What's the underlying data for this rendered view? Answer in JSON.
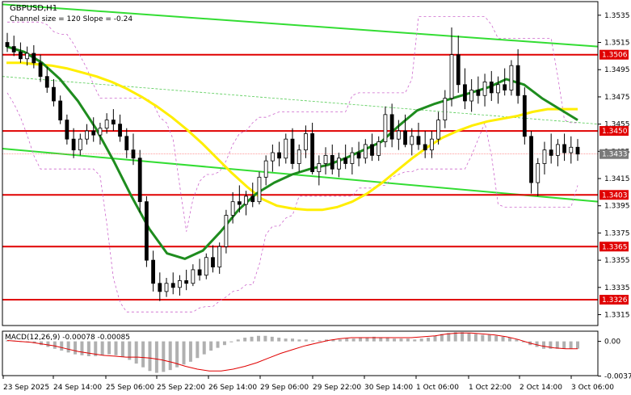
{
  "chart_data": {
    "type": "candlestick",
    "symbol_title": "GBPUSD,H1",
    "subtitle": "Channel size = 120 Slope = -0.24",
    "price_axis": {
      "ylim": [
        1.3307,
        1.3545
      ],
      "ticks": [
        "1.3535",
        "1.3515",
        "1.3495",
        "1.3475",
        "1.3455",
        "1.3435",
        "1.3415",
        "1.3395",
        "1.3375",
        "1.3355",
        "1.3335",
        "1.3315"
      ]
    },
    "levels": [
      {
        "label": "1.3506",
        "value": 1.3506
      },
      {
        "label": "1.3450",
        "value": 1.345
      },
      {
        "label": "1.3403",
        "value": 1.3403
      },
      {
        "label": "1.3365",
        "value": 1.3365
      },
      {
        "label": "1.3326",
        "value": 1.3326
      }
    ],
    "current_price": {
      "label": "1.3433",
      "value": 1.3433
    },
    "x_labels": [
      "23 Sep 2025",
      "24 Sep 14:00",
      "25 Sep 06:00",
      "25 Sep 22:00",
      "26 Sep 14:00",
      "29 Sep 06:00",
      "29 Sep 22:00",
      "30 Sep 14:00",
      "1 Oct 06:00",
      "1 Oct 22:00",
      "2 Oct 14:00",
      "3 Oct 06:00"
    ],
    "candles_ohlc": [
      [
        1.3515,
        1.3522,
        1.3508,
        1.3512
      ],
      [
        1.3512,
        1.352,
        1.3505,
        1.3508
      ],
      [
        1.3508,
        1.3515,
        1.35,
        1.3503
      ],
      [
        1.3503,
        1.3512,
        1.3498,
        1.3507
      ],
      [
        1.3507,
        1.3513,
        1.3496,
        1.35
      ],
      [
        1.35,
        1.3506,
        1.3486,
        1.349
      ],
      [
        1.349,
        1.3497,
        1.3478,
        1.3482
      ],
      [
        1.3482,
        1.3488,
        1.3468,
        1.3472
      ],
      [
        1.3472,
        1.3476,
        1.3455,
        1.3458
      ],
      [
        1.3458,
        1.3462,
        1.344,
        1.3444
      ],
      [
        1.3444,
        1.3452,
        1.343,
        1.3436
      ],
      [
        1.3436,
        1.3448,
        1.3432,
        1.3444
      ],
      [
        1.3444,
        1.3455,
        1.344,
        1.345
      ],
      [
        1.345,
        1.346,
        1.3442,
        1.3447
      ],
      [
        1.3447,
        1.3456,
        1.344,
        1.3452
      ],
      [
        1.3452,
        1.3463,
        1.3448,
        1.3458
      ],
      [
        1.3458,
        1.3466,
        1.345,
        1.3455
      ],
      [
        1.3455,
        1.3462,
        1.3442,
        1.3446
      ],
      [
        1.3446,
        1.3452,
        1.343,
        1.3436
      ],
      [
        1.3436,
        1.3448,
        1.3425,
        1.343
      ],
      [
        1.343,
        1.3436,
        1.339,
        1.3398
      ],
      [
        1.3398,
        1.3402,
        1.335,
        1.3355
      ],
      [
        1.3355,
        1.3362,
        1.3332,
        1.3338
      ],
      [
        1.3338,
        1.3346,
        1.3325,
        1.3332
      ],
      [
        1.3332,
        1.3342,
        1.3328,
        1.3338
      ],
      [
        1.3338,
        1.3346,
        1.333,
        1.3335
      ],
      [
        1.3335,
        1.3344,
        1.3329,
        1.334
      ],
      [
        1.334,
        1.3348,
        1.3333,
        1.3338
      ],
      [
        1.3338,
        1.3352,
        1.3336,
        1.3348
      ],
      [
        1.3348,
        1.3356,
        1.334,
        1.3344
      ],
      [
        1.3344,
        1.336,
        1.3341,
        1.3357
      ],
      [
        1.3357,
        1.3366,
        1.3346,
        1.335
      ],
      [
        1.335,
        1.3368,
        1.3345,
        1.3365
      ],
      [
        1.3365,
        1.3392,
        1.336,
        1.3388
      ],
      [
        1.3388,
        1.3405,
        1.3382,
        1.3398
      ],
      [
        1.3398,
        1.341,
        1.339,
        1.3396
      ],
      [
        1.3396,
        1.3406,
        1.3388,
        1.3402
      ],
      [
        1.3402,
        1.3412,
        1.3394,
        1.3398
      ],
      [
        1.3398,
        1.342,
        1.3396,
        1.3416
      ],
      [
        1.3416,
        1.3432,
        1.341,
        1.3428
      ],
      [
        1.3428,
        1.344,
        1.342,
        1.3434
      ],
      [
        1.3434,
        1.3442,
        1.3424,
        1.343
      ],
      [
        1.343,
        1.3448,
        1.3426,
        1.3444
      ],
      [
        1.3444,
        1.3452,
        1.3422,
        1.3426
      ],
      [
        1.3426,
        1.344,
        1.342,
        1.3436
      ],
      [
        1.3436,
        1.3454,
        1.343,
        1.3448
      ],
      [
        1.3448,
        1.3456,
        1.3418,
        1.342
      ],
      [
        1.342,
        1.3432,
        1.341,
        1.3426
      ],
      [
        1.3426,
        1.3438,
        1.3418,
        1.3432
      ],
      [
        1.3432,
        1.344,
        1.3418,
        1.3422
      ],
      [
        1.3422,
        1.3434,
        1.3416,
        1.343
      ],
      [
        1.343,
        1.344,
        1.3422,
        1.3426
      ],
      [
        1.3426,
        1.3438,
        1.3418,
        1.3434
      ],
      [
        1.3434,
        1.3442,
        1.3424,
        1.343
      ],
      [
        1.343,
        1.3444,
        1.3426,
        1.344
      ],
      [
        1.344,
        1.3448,
        1.3428,
        1.3432
      ],
      [
        1.3432,
        1.3446,
        1.3428,
        1.3442
      ],
      [
        1.3442,
        1.3468,
        1.3438,
        1.3462
      ],
      [
        1.3462,
        1.347,
        1.3438,
        1.3444
      ],
      [
        1.3444,
        1.3458,
        1.3436,
        1.345
      ],
      [
        1.345,
        1.3462,
        1.3438,
        1.344
      ],
      [
        1.344,
        1.3452,
        1.3432,
        1.3446
      ],
      [
        1.3446,
        1.3456,
        1.3436,
        1.344
      ],
      [
        1.344,
        1.345,
        1.343,
        1.3436
      ],
      [
        1.3436,
        1.345,
        1.343,
        1.3444
      ],
      [
        1.3444,
        1.3464,
        1.344,
        1.3458
      ],
      [
        1.3458,
        1.348,
        1.3452,
        1.3474
      ],
      [
        1.3474,
        1.3526,
        1.3468,
        1.3506
      ],
      [
        1.3506,
        1.352,
        1.3478,
        1.3484
      ],
      [
        1.3484,
        1.3496,
        1.3466,
        1.3472
      ],
      [
        1.3472,
        1.3488,
        1.3464,
        1.348
      ],
      [
        1.348,
        1.349,
        1.347,
        1.3476
      ],
      [
        1.3476,
        1.3492,
        1.3468,
        1.3486
      ],
      [
        1.3486,
        1.3494,
        1.3472,
        1.3478
      ],
      [
        1.3478,
        1.349,
        1.347,
        1.3484
      ],
      [
        1.3484,
        1.3496,
        1.3476,
        1.348
      ],
      [
        1.348,
        1.3502,
        1.3476,
        1.3498
      ],
      [
        1.3498,
        1.351,
        1.347,
        1.3476
      ],
      [
        1.3476,
        1.3482,
        1.344,
        1.3446
      ],
      [
        1.3446,
        1.345,
        1.3404,
        1.3412
      ],
      [
        1.3412,
        1.343,
        1.3402,
        1.3426
      ],
      [
        1.3426,
        1.3442,
        1.3418,
        1.3436
      ],
      [
        1.3436,
        1.3448,
        1.3426,
        1.3432
      ],
      [
        1.3432,
        1.3444,
        1.3424,
        1.344
      ],
      [
        1.344,
        1.3448,
        1.3428,
        1.3434
      ],
      [
        1.3434,
        1.3446,
        1.3426,
        1.3438
      ],
      [
        1.3438,
        1.3444,
        1.3428,
        1.3433
      ]
    ],
    "ma_yellow": [
      1.35,
      1.35,
      1.3499,
      1.3498,
      1.3496,
      1.3493,
      1.349,
      1.3486,
      1.3481,
      1.3475,
      1.3468,
      1.346,
      1.3451,
      1.3441,
      1.343,
      1.3419,
      1.3409,
      1.34,
      1.3395,
      1.3393,
      1.3392,
      1.3392,
      1.3394,
      1.3398,
      1.3404,
      1.3412,
      1.3421,
      1.343,
      1.3438,
      1.3445,
      1.345,
      1.3454,
      1.3457,
      1.3459,
      1.3461,
      1.3464,
      1.3466,
      1.3466,
      1.3466
    ],
    "ma_green": [
      1.3512,
      1.3508,
      1.35,
      1.3488,
      1.3472,
      1.3452,
      1.3428,
      1.3402,
      1.3378,
      1.336,
      1.3356,
      1.3362,
      1.3376,
      1.3392,
      1.3404,
      1.3412,
      1.3418,
      1.3422,
      1.3425,
      1.343,
      1.3436,
      1.3442,
      1.3454,
      1.3465,
      1.347,
      1.3474,
      1.3478,
      1.3482,
      1.3488,
      1.3484,
      1.3474,
      1.3466,
      1.3458
    ],
    "channel_upper": [
      1.3543,
      1.3512
    ],
    "channel_lower": [
      1.3437,
      1.3398
    ],
    "channel_mid": [
      1.349,
      1.3455
    ],
    "macd": {
      "label": "MACD(12,26,9) -0.00078 -0.00085",
      "ylim": [
        -0.0037,
        0.0011
      ],
      "ticks": [
        "0.00",
        "-0.00375"
      ],
      "histogram": [
        0.0001,
        0.0001,
        0.0,
        -0.0001,
        -0.0002,
        -0.0004,
        -0.0006,
        -0.0008,
        -0.001,
        -0.0012,
        -0.0014,
        -0.0015,
        -0.0016,
        -0.0016,
        -0.0015,
        -0.0014,
        -0.0015,
        -0.0017,
        -0.002,
        -0.0024,
        -0.0028,
        -0.0032,
        -0.0034,
        -0.0033,
        -0.0031,
        -0.0028,
        -0.0025,
        -0.0022,
        -0.0018,
        -0.0014,
        -0.001,
        -0.0007,
        -0.0004,
        -0.0001,
        0.0002,
        0.0004,
        0.0005,
        0.0006,
        0.0006,
        0.0005,
        0.0004,
        0.0003,
        0.0003,
        0.0002,
        0.0002,
        0.0001,
        0.0001,
        0.0002,
        0.0002,
        0.0002,
        0.0003,
        0.0003,
        0.0004,
        0.0004,
        0.0005,
        0.0004,
        0.0004,
        0.0003,
        0.0003,
        0.0003,
        0.0002,
        0.0003,
        0.0004,
        0.0006,
        0.0008,
        0.0009,
        0.001,
        0.001,
        0.0009,
        0.0008,
        0.0007,
        0.0007,
        0.0006,
        0.0005,
        0.0004,
        0.0002,
        -0.0001,
        -0.0004,
        -0.0006,
        -0.0008,
        -0.0008,
        -0.0008,
        -0.0008,
        -0.0008,
        -0.0008
      ],
      "signal": [
        0.0001,
        0.0,
        -0.0001,
        -0.0003,
        -0.0005,
        -0.0008,
        -0.0011,
        -0.0013,
        -0.0015,
        -0.0016,
        -0.0017,
        -0.0017,
        -0.0018,
        -0.002,
        -0.0023,
        -0.0027,
        -0.003,
        -0.0032,
        -0.0032,
        -0.003,
        -0.0027,
        -0.0023,
        -0.0018,
        -0.0013,
        -0.0009,
        -0.0005,
        -0.0002,
        0.0001,
        0.0003,
        0.0004,
        0.0004,
        0.0004,
        0.0004,
        0.0004,
        0.0004,
        0.0005,
        0.0006,
        0.0008,
        0.0009,
        0.0009,
        0.0008,
        0.0007,
        0.0005,
        0.0002,
        -0.0002,
        -0.0005,
        -0.0007,
        -0.0008,
        -0.0008
      ]
    },
    "colors": {
      "candle": "#000000",
      "level_line": "#e00000",
      "level_tag_bg": "#e00000",
      "level_tag_text": "#ffffff",
      "ma_yellow": "#ffee00",
      "ma_green": "#1e8c1e",
      "channel": "#33dd33",
      "bands": "#cc66cc",
      "macd_hist": "#b0b0b0",
      "macd_signal": "#e00000",
      "price_tag_bg": "#7a7a7a"
    }
  }
}
